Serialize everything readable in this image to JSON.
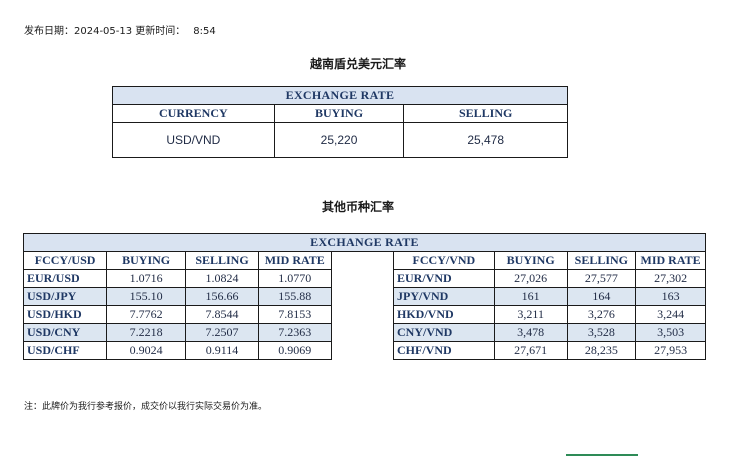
{
  "header": {
    "publish_label": "发布日期：2024-05-13 更新时间：",
    "publish_time": "8:54"
  },
  "main_section": {
    "title": "越南盾兑美元汇率",
    "band": "EXCHANGE RATE",
    "columns": [
      "CURRENCY",
      "BUYING",
      "SELLING"
    ],
    "row": {
      "currency": "USD/VND",
      "buying": "25,220",
      "selling": "25,478"
    }
  },
  "other_section": {
    "title": "其他币种汇率",
    "band": "EXCHANGE  RATE",
    "left_columns": [
      "FCCY/USD",
      "BUYING",
      "SELLING",
      "MID RATE"
    ],
    "right_columns": [
      "FCCY/VND",
      "BUYING",
      "SELLING",
      "MID RATE"
    ],
    "rows": [
      {
        "l_pair": "EUR/USD",
        "l_buy": "1.0716",
        "l_sell": "1.0824",
        "l_mid": "1.0770",
        "r_pair": "EUR/VND",
        "r_buy": "27,026",
        "r_sell": "27,577",
        "r_mid": "27,302"
      },
      {
        "l_pair": "USD/JPY",
        "l_buy": "155.10",
        "l_sell": "156.66",
        "l_mid": "155.88",
        "r_pair": "JPY/VND",
        "r_buy": "161",
        "r_sell": "164",
        "r_mid": "163"
      },
      {
        "l_pair": "USD/HKD",
        "l_buy": "7.7762",
        "l_sell": "7.8544",
        "l_mid": "7.8153",
        "r_pair": "HKD/VND",
        "r_buy": "3,211",
        "r_sell": "3,276",
        "r_mid": "3,244"
      },
      {
        "l_pair": "USD/CNY",
        "l_buy": "7.2218",
        "l_sell": "7.2507",
        "l_mid": "7.2363",
        "r_pair": "CNY/VND",
        "r_buy": "3,478",
        "r_sell": "3,528",
        "r_mid": "3,503"
      },
      {
        "l_pair": "USD/CHF",
        "l_buy": "0.9024",
        "l_sell": "0.9114",
        "l_mid": "0.9069",
        "r_pair": "CHF/VND",
        "r_buy": "27,671",
        "r_sell": "28,235",
        "r_mid": "27,953"
      }
    ]
  },
  "footer": {
    "note": "注：此牌价为我行参考报价，成交价以我行实际交易价为准。"
  },
  "colors": {
    "header_band": "#d9e3f1",
    "header_text": "#1f3864",
    "row_shade": "#dce6f1",
    "accent_line": "#2e8b57"
  }
}
